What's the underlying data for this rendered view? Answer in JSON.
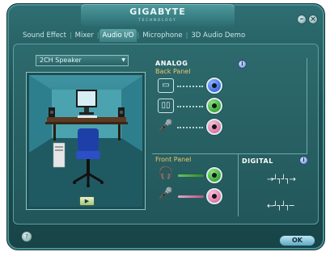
{
  "window": {
    "brand": "GIGABYTE",
    "brand_sub": "TECHNOLOGY",
    "min_icon": "minimize-icon",
    "close_icon": "close-icon"
  },
  "tabs": [
    {
      "label": "Sound Effect"
    },
    {
      "label": "Mixer"
    },
    {
      "label": "Audio I/O",
      "active": true
    },
    {
      "label": "Microphone"
    },
    {
      "label": "3D Audio Demo"
    }
  ],
  "speaker_select": {
    "value": "2CH Speaker"
  },
  "analog": {
    "title": "ANALOG",
    "back_panel": "Back Panel",
    "jack_colors": [
      "#1f4fd6",
      "#1d8d1b",
      "#d2578e"
    ]
  },
  "front_panel": {
    "title": "Front Panel"
  },
  "digital": {
    "title": "DIGITAL"
  },
  "footer": {
    "ok_label": "OK"
  }
}
